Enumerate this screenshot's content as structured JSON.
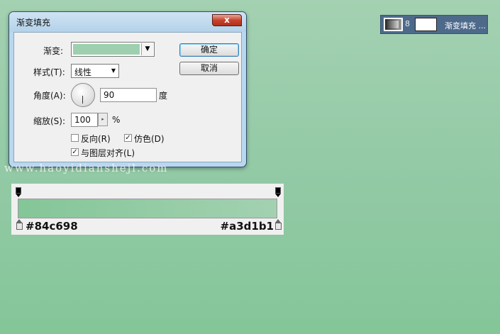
{
  "dialog": {
    "title": "渐变填充",
    "close_glyph": "x",
    "gradient_label": "渐变:",
    "style_label": "样式(T):",
    "style_value": "线性",
    "angle_label": "角度(A):",
    "angle_value": "90",
    "angle_unit": "度",
    "scale_label": "缩放(S):",
    "scale_value": "100",
    "scale_unit": "%",
    "reverse_label": "反向(R)",
    "reverse_checked": false,
    "dither_label": "仿色(D)",
    "dither_checked": true,
    "align_label": "与图层对齐(L)",
    "align_checked": true,
    "ok_label": "确定",
    "cancel_label": "取消"
  },
  "layer": {
    "name": "渐变填充 ...",
    "chain_glyph": "8"
  },
  "watermark": "www.haoyidianshejl.com",
  "gradient_editor": {
    "start_color": "#84c698",
    "end_color": "#a3d1b1"
  },
  "colors": {
    "start": "#84c698",
    "end": "#a3d1b1",
    "close_button": "#c7432c",
    "layer_bg": "#4d6a8b"
  },
  "icons": {
    "combo_arrow": "▼",
    "check": "✓",
    "stepper": "▸"
  }
}
